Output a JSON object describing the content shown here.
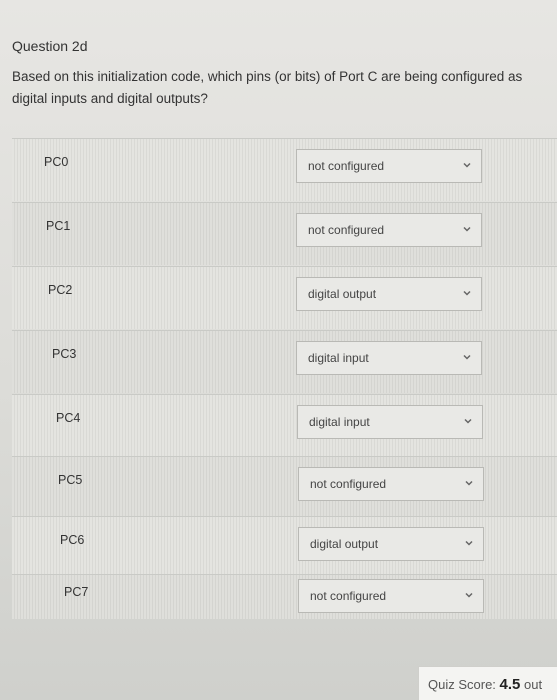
{
  "question": {
    "title": "Question 2d",
    "text": "Based on this initialization code, which pins (or bits) of Port C are being configured as digital inputs and digital outputs?"
  },
  "rows": [
    {
      "pin": "PC0",
      "selected": "not configured"
    },
    {
      "pin": "PC1",
      "selected": "not configured"
    },
    {
      "pin": "PC2",
      "selected": "digital output"
    },
    {
      "pin": "PC3",
      "selected": "digital input"
    },
    {
      "pin": "PC4",
      "selected": "digital input"
    },
    {
      "pin": "PC5",
      "selected": "not configured"
    },
    {
      "pin": "PC6",
      "selected": "digital output"
    },
    {
      "pin": "PC7",
      "selected": "not configured"
    }
  ],
  "quiz_score": {
    "label": "Quiz Score:",
    "value": "4.5",
    "suffix": "out"
  }
}
